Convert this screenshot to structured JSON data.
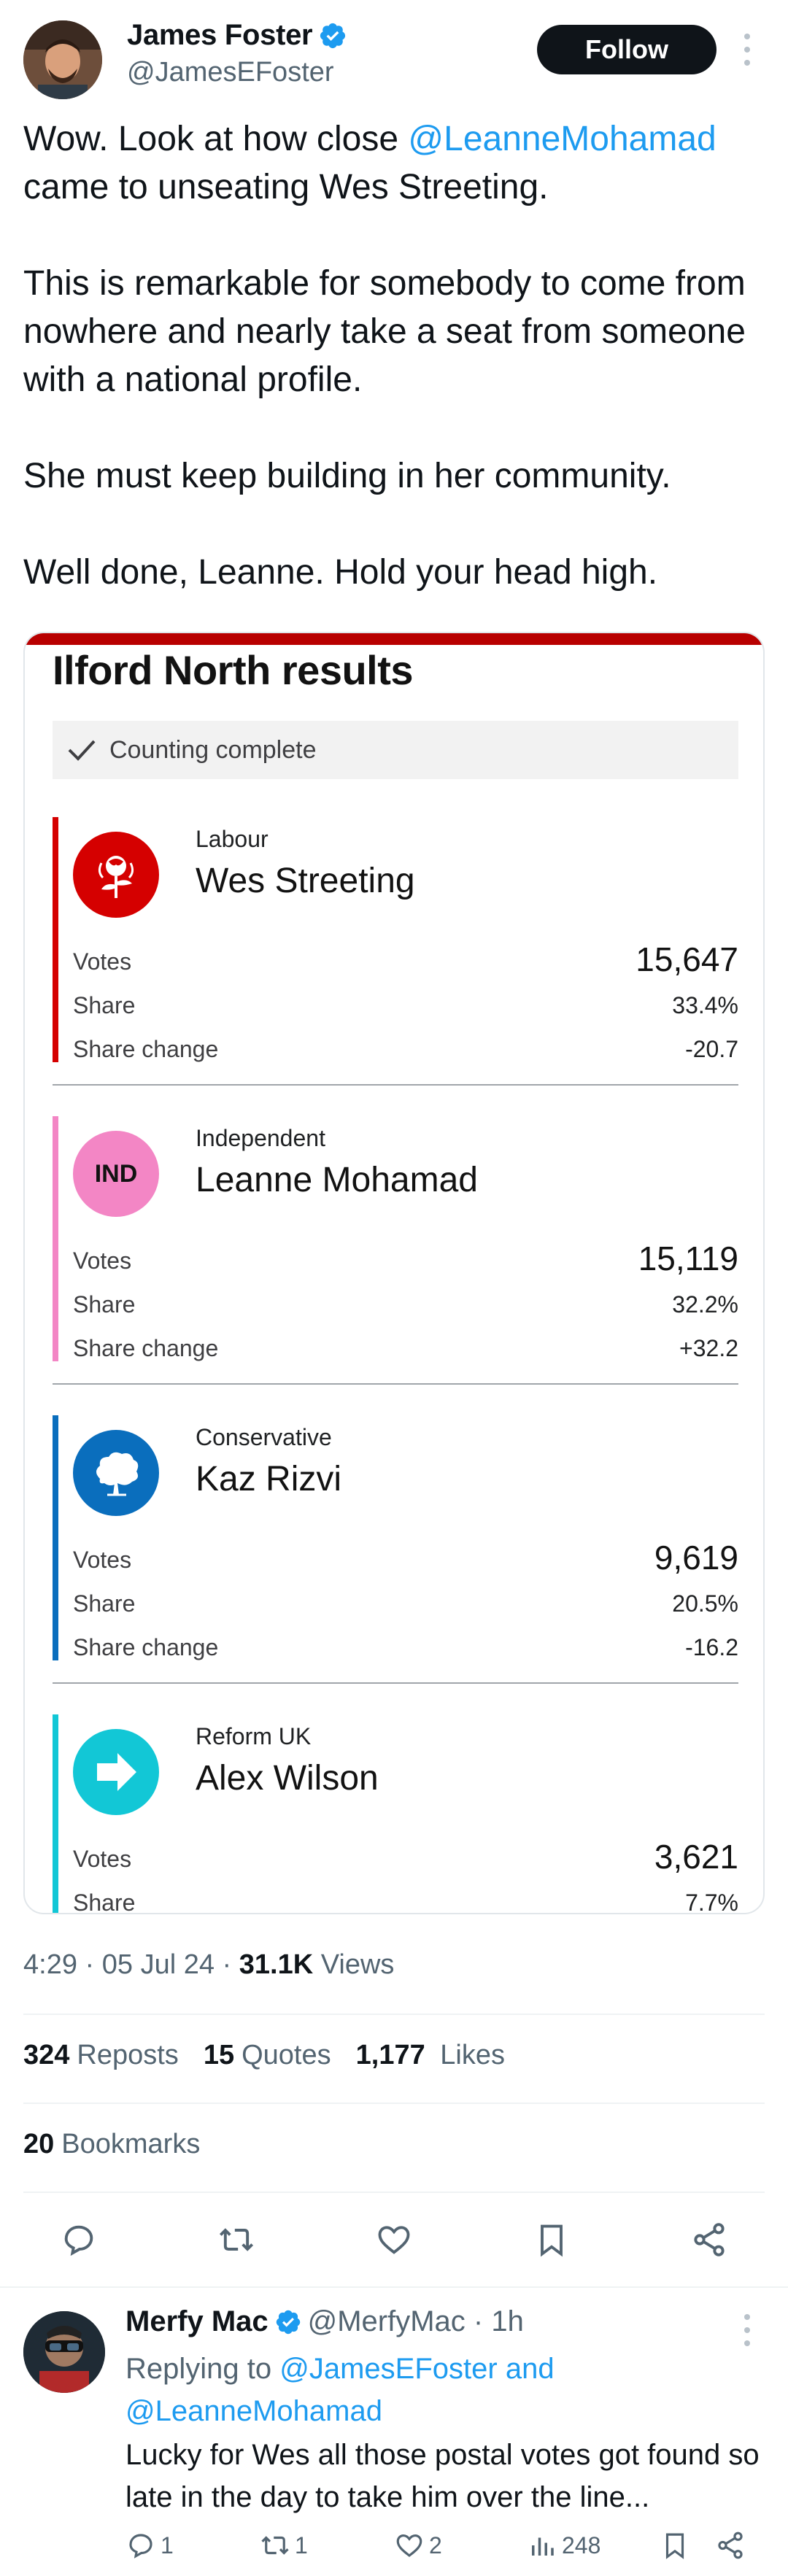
{
  "tweet": {
    "author": {
      "name": "James Foster",
      "handle": "@JamesEFoster",
      "verified": true
    },
    "follow_label": "Follow",
    "text": {
      "line1_prefix": "Wow. Look at how close ",
      "line1_mention": "@LeanneMohamad",
      "line1_suffix": "came to unseating Wes Streeting.",
      "para2": "This is remarkable for somebody to come from nowhere and nearly take a seat from someone with a national profile.",
      "para3": "She must keep building in her community.",
      "para4": "Well done, Leanne. Hold your head high."
    },
    "time": "4:29",
    "date": "05 Jul 24",
    "views_count": "31.1K",
    "views_label": "Views",
    "reposts_count": "324",
    "reposts_label": "Reposts",
    "quotes_count": "15",
    "quotes_label": "Quotes",
    "likes_count": "1,177",
    "likes_label": "Likes",
    "bookmarks_count": "20",
    "bookmarks_label": "Bookmarks"
  },
  "results_card": {
    "title": "Ilford North results",
    "status": "Counting complete",
    "labels": {
      "votes": "Votes",
      "share": "Share",
      "share_change": "Share change"
    },
    "candidates": [
      {
        "party": "Labour",
        "name": "Wes Streeting",
        "votes": "15,647",
        "share": "33.4%",
        "share_change": "-20.7",
        "color": "#d50000",
        "logo": "labour-rose-icon"
      },
      {
        "party": "Independent",
        "name": "Leanne Mohamad",
        "votes": "15,119",
        "share": "32.2%",
        "share_change": "+32.2",
        "color": "#f386c5",
        "logo_text": "IND"
      },
      {
        "party": "Conservative",
        "name": "Kaz Rizvi",
        "votes": "9,619",
        "share": "20.5%",
        "share_change": "-16.2",
        "color": "#0a6ebd",
        "logo": "conservative-tree-icon"
      },
      {
        "party": "Reform UK",
        "name": "Alex Wilson",
        "votes": "3,621",
        "share": "7.7%",
        "color": "#12c7d6",
        "logo": "reform-arrow-icon"
      }
    ]
  },
  "reply": {
    "name": "Merfy Mac",
    "handle": "@MerfyMac",
    "age": "1h",
    "replying_prefix": "Replying to",
    "replying_to_1": "@JamesEFoster",
    "replying_and": "and",
    "replying_to_2": "@LeanneMohamad",
    "text": "Lucky for Wes all those postal votes got found so late in the day to take him over the line...",
    "reply_count": "1",
    "repost_count": "1",
    "like_count": "2",
    "view_count": "248"
  },
  "colors": {
    "accent": "#1d9bf0",
    "bbc_red": "#b80000"
  }
}
